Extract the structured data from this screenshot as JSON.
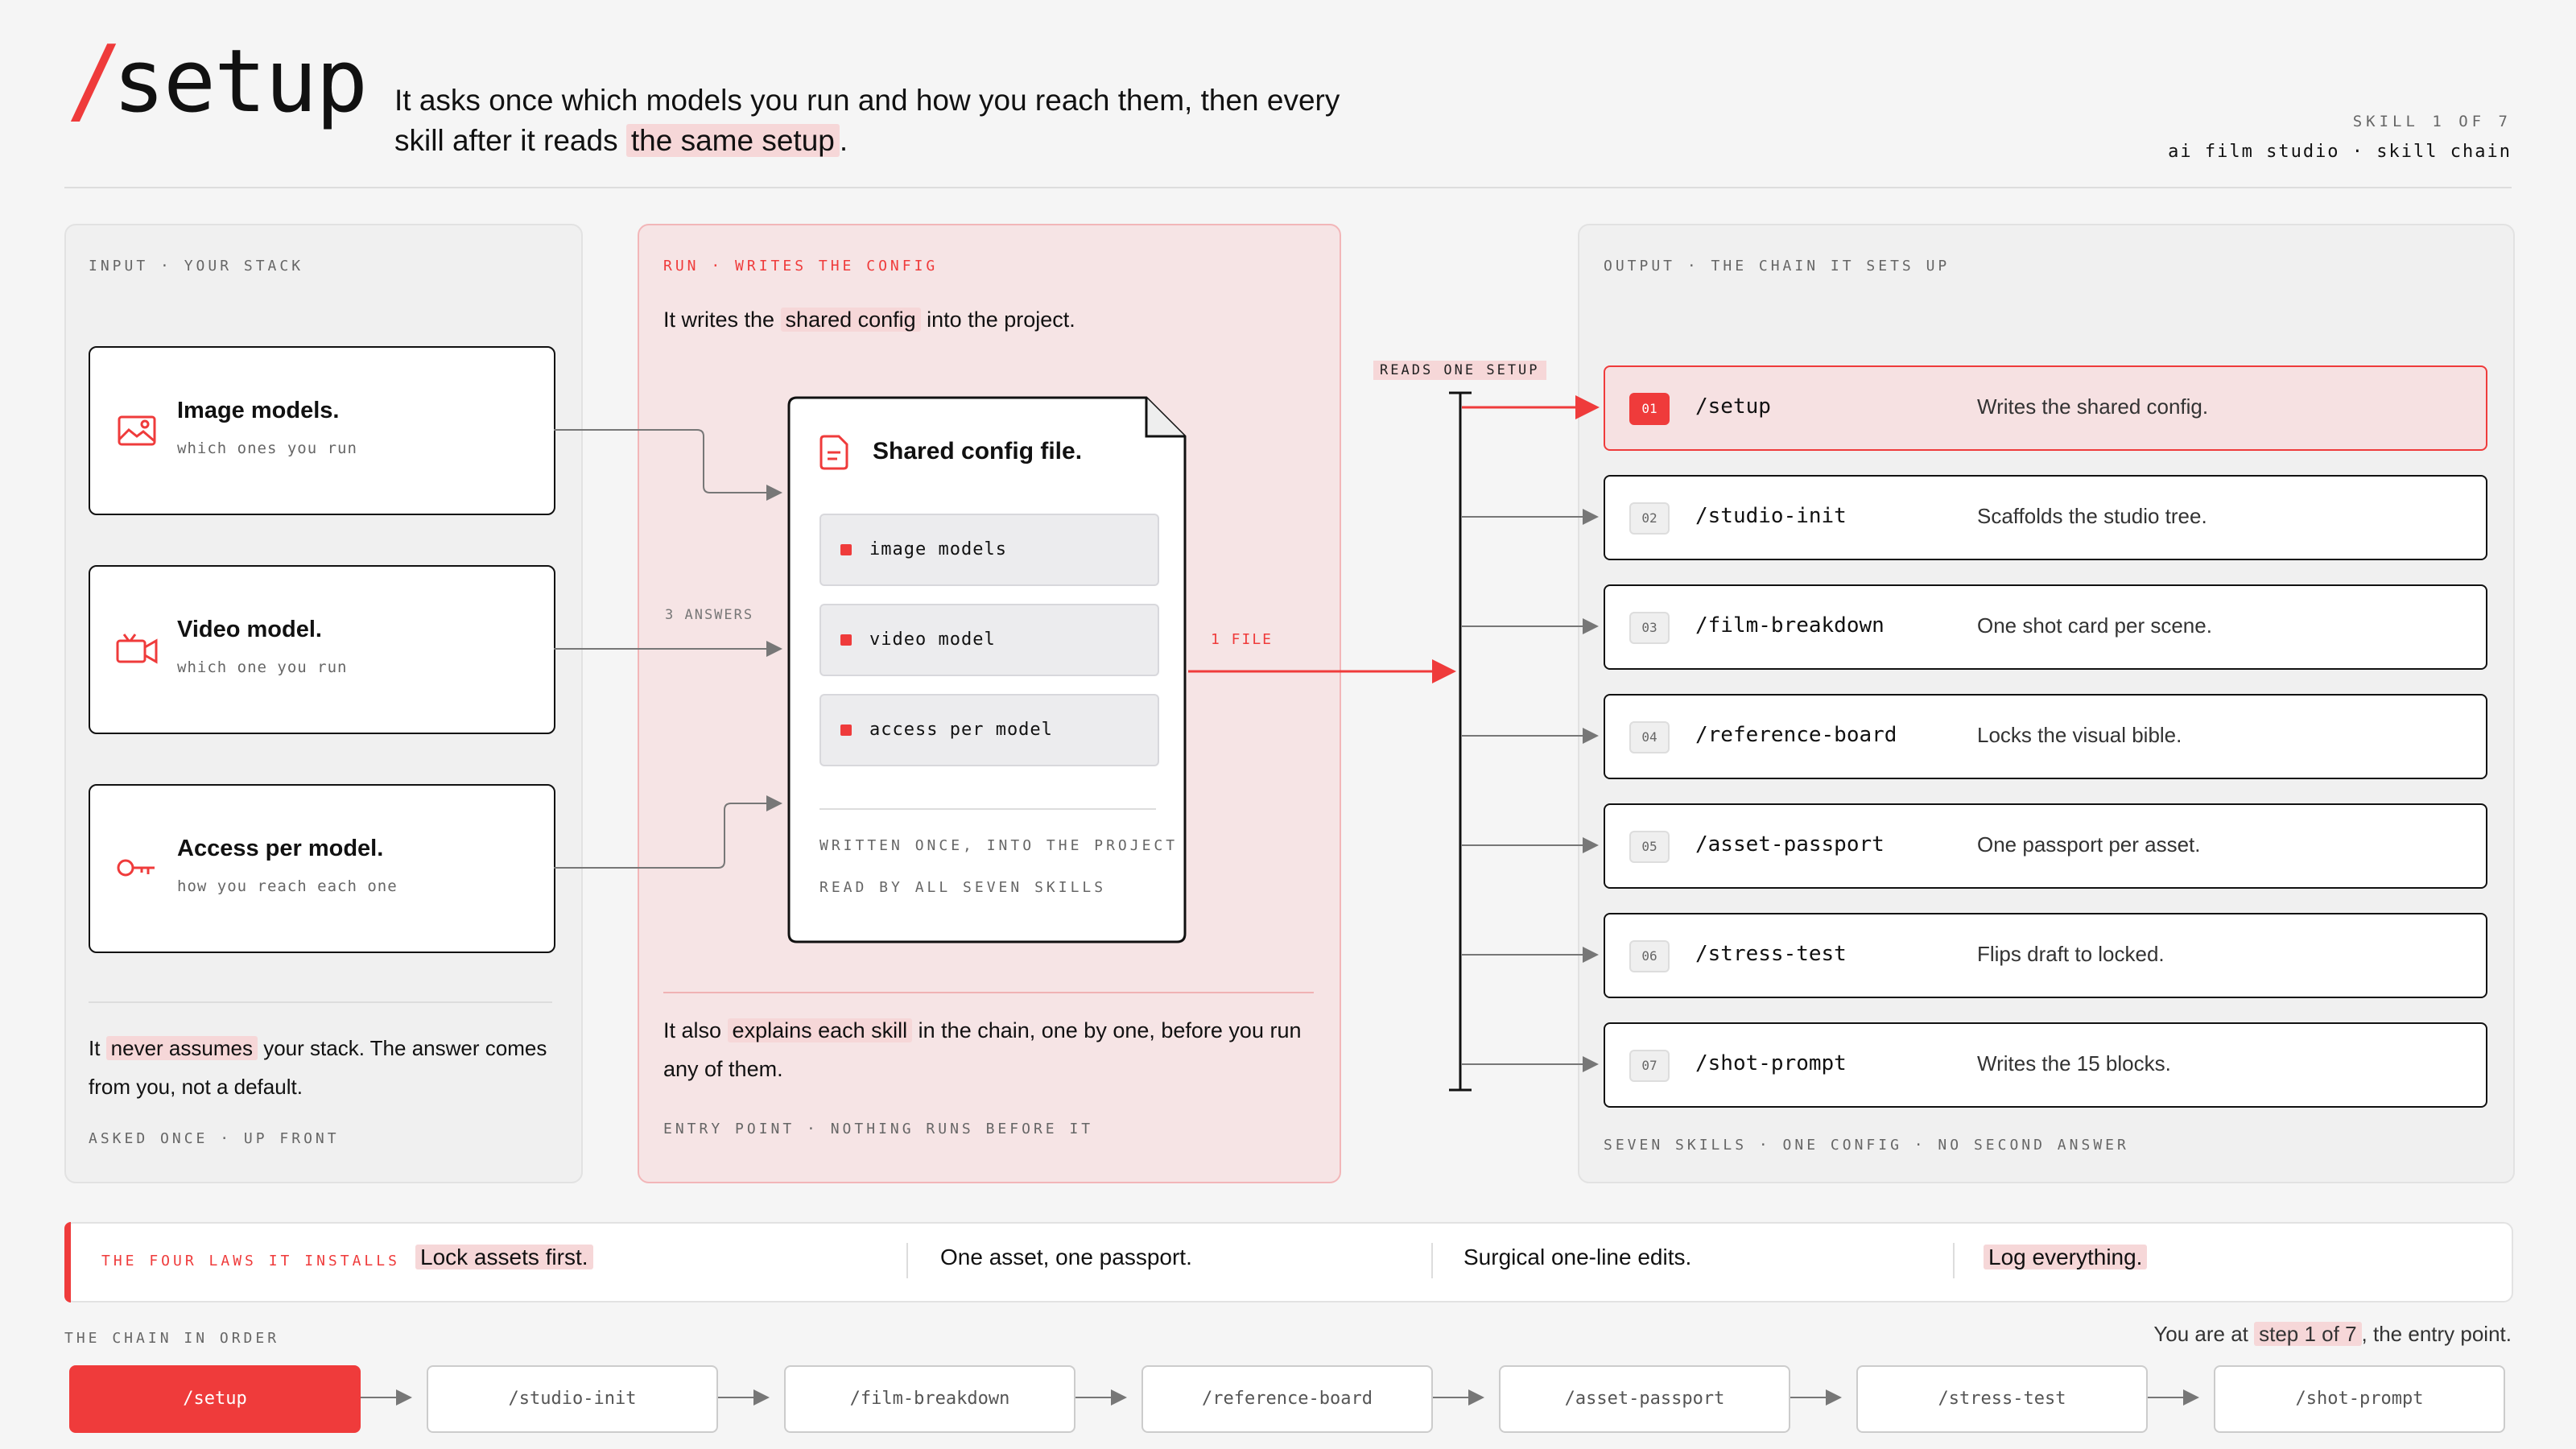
{
  "header": {
    "slash": "/",
    "title": "setup",
    "tagline_parts": [
      "It asks once which models you run and how you reach them, then every skill after it reads ",
      "the same setup",
      "."
    ],
    "skill_num": "SKILL 1 OF 7",
    "studio": "ai film studio · skill chain"
  },
  "input_panel": {
    "label": "INPUT · YOUR STACK",
    "cards": [
      {
        "title": "Image models.",
        "sub": "which ones you run",
        "icon": "image-icon"
      },
      {
        "title": "Video model.",
        "sub": "which one you run",
        "icon": "video-camera-icon"
      },
      {
        "title": "Access per model.",
        "sub": "how you reach each one",
        "icon": "key-icon"
      }
    ],
    "note_parts": [
      "It ",
      "never assumes",
      " your stack. The answer comes from you, not a default."
    ],
    "foot": "ASKED ONCE · UP FRONT"
  },
  "run_panel": {
    "label": "RUN · WRITES THE CONFIG",
    "lead_parts": [
      "It writes the ",
      "shared config",
      " into the project."
    ],
    "config_title": "Shared config file.",
    "config_items": [
      "image models",
      "video model",
      "access per model"
    ],
    "config_note1": "WRITTEN ONCE, INTO THE PROJECT",
    "config_note2": "READ BY ALL SEVEN SKILLS",
    "explain_parts": [
      "It also ",
      "explains each skill",
      " in the chain, one by one, before you run any of them."
    ],
    "foot": "ENTRY POINT · NOTHING RUNS BEFORE IT",
    "answers_label": "3 ANSWERS",
    "file_label": "1 FILE"
  },
  "output_panel": {
    "label": "OUTPUT · THE CHAIN IT SETS UP",
    "reads_label": "READS ONE SETUP",
    "rows": [
      {
        "num": "01",
        "cmd": "/setup",
        "desc": "Writes the shared config."
      },
      {
        "num": "02",
        "cmd": "/studio-init",
        "desc": "Scaffolds the studio tree."
      },
      {
        "num": "03",
        "cmd": "/film-breakdown",
        "desc": "One shot card per scene."
      },
      {
        "num": "04",
        "cmd": "/reference-board",
        "desc": "Locks the visual bible."
      },
      {
        "num": "05",
        "cmd": "/asset-passport",
        "desc": "One passport per asset."
      },
      {
        "num": "06",
        "cmd": "/stress-test",
        "desc": "Flips draft to locked."
      },
      {
        "num": "07",
        "cmd": "/shot-prompt",
        "desc": "Writes the 15 blocks."
      }
    ],
    "foot": "SEVEN SKILLS · ONE CONFIG · NO SECOND ANSWER"
  },
  "laws": {
    "label": "THE FOUR LAWS IT INSTALLS",
    "items": [
      "Lock assets first.",
      "One asset, one passport.",
      "Surgical one-line edits.",
      "Log everything."
    ]
  },
  "chain": {
    "label": "THE CHAIN IN ORDER",
    "step_note_parts": [
      "You are at ",
      "step 1 of 7",
      ", the entry point."
    ],
    "chips": [
      "/setup",
      "/studio-init",
      "/film-breakdown",
      "/reference-board",
      "/asset-passport",
      "/stress-test",
      "/shot-prompt"
    ]
  },
  "colors": {
    "accent": "#ef3b3b",
    "highlight": "#f6d7d8",
    "run_bg": "#f6e4e5"
  }
}
